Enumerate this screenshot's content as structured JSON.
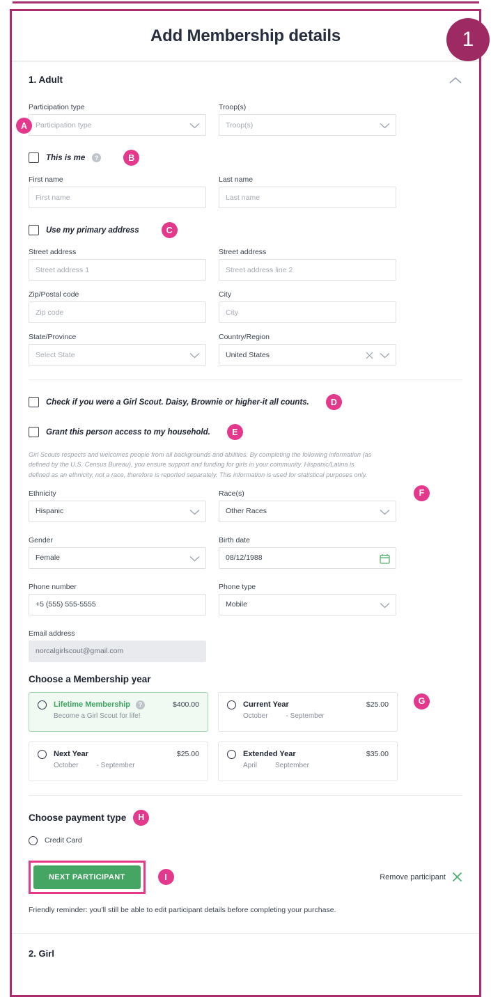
{
  "header": {
    "title": "Add Membership details",
    "badge": "1"
  },
  "accordion": {
    "title": "1. Adult",
    "collapse_icon": "chevron-up-icon"
  },
  "fields": {
    "participation_type": {
      "label": "Participation type",
      "placeholder": "Participation type",
      "value": ""
    },
    "troops": {
      "label": "Troop(s)",
      "placeholder": "Troop(s)",
      "value": ""
    },
    "first_name": {
      "label": "First name",
      "placeholder": "First name",
      "value": ""
    },
    "last_name": {
      "label": "Last name",
      "placeholder": "Last name",
      "value": ""
    },
    "street1": {
      "label": "Street address",
      "placeholder": "Street address 1",
      "value": ""
    },
    "street2": {
      "label": "Street address",
      "placeholder": "Street address line 2",
      "value": ""
    },
    "zip": {
      "label": "Zip/Postal code",
      "placeholder": "Zip code",
      "value": ""
    },
    "city": {
      "label": "City",
      "placeholder": "City",
      "value": ""
    },
    "state": {
      "label": "State/Province",
      "placeholder": "Select State",
      "value": ""
    },
    "country": {
      "label": "Country/Region",
      "value": "United States"
    },
    "ethnicity": {
      "label": "Ethnicity",
      "value": "Hispanic"
    },
    "races": {
      "label": "Race(s)",
      "value": "Other Races"
    },
    "gender": {
      "label": "Gender",
      "value": "Female"
    },
    "birth_date": {
      "label": "Birth date",
      "value": "08/12/1988"
    },
    "phone_number": {
      "label": "Phone number",
      "value": "+5 (555) 555-5555"
    },
    "phone_type": {
      "label": "Phone type",
      "value": "Mobile"
    },
    "email": {
      "label": "Email address",
      "value": "norcalgirlscout@gmail.com"
    }
  },
  "checkboxes": {
    "this_is_me": {
      "label": "This is me",
      "badge": "B"
    },
    "primary_address": {
      "label": "Use my primary address",
      "badge": "C"
    },
    "was_girl_scout": {
      "label": "Check if you were a Girl Scout. Daisy, Brownie or higher-it all counts.",
      "badge": "D"
    },
    "grant_access": {
      "label": "Grant this person access to my household.",
      "badge": "E"
    }
  },
  "badges": {
    "a": "A",
    "f": "F",
    "g": "G",
    "h": "H",
    "i": "I"
  },
  "disclaimer": "Girl Scouts respects and welcomes people from all backgrounds and abilities. By completing the following information (as defined by the U.S. Census Bureau), you ensure support and funding for girls in your community. Hispanic/Latina is defined as an ethnicity, not a race, therefore is reported separately. This information is used for statistical purposes only.",
  "membership": {
    "heading": "Choose a Membership year",
    "options": [
      {
        "name": "Lifetime Membership",
        "price": "$400.00",
        "sub_start": "Become a Girl Scout for life!",
        "sub_end": "",
        "selected_style": true,
        "has_help": true
      },
      {
        "name": "Current Year",
        "price": "$25.00",
        "sub_start": "October",
        "sub_end": "- September",
        "selected_style": false,
        "has_help": false
      },
      {
        "name": "Next Year",
        "price": "$25.00",
        "sub_start": "October",
        "sub_end": "- September",
        "selected_style": false,
        "has_help": false
      },
      {
        "name": "Extended Year",
        "price": "$35.00",
        "sub_start": "April",
        "sub_end": "September",
        "selected_style": false,
        "has_help": false
      }
    ]
  },
  "payment": {
    "heading": "Choose payment type",
    "option": "Credit Card"
  },
  "actions": {
    "next_participant": "NEXT PARTICIPANT",
    "remove_participant": "Remove participant",
    "note": "Friendly reminder: you'll still be able to edit participant details before completing your purchase."
  },
  "footer": {
    "title": "2. Girl"
  },
  "colors": {
    "brand_magenta": "#a82c6e",
    "badge_pink": "#e3388c",
    "badge_dark": "#9e2a64",
    "green": "#45a663",
    "green_light": "#f0f9f2"
  }
}
